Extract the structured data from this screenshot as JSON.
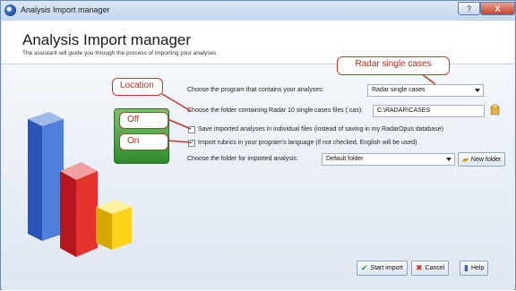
{
  "window": {
    "title": "Analysis Import manager",
    "help_glyph": "?",
    "close_glyph": "X"
  },
  "header": {
    "title": "Analysis Import manager",
    "subtitle": "The assistant will guide you through the process of importing your analyses"
  },
  "form": {
    "program_label": "Choose the program that contains your analyses:",
    "program_value": "Radar single cases",
    "folder_label": "Choose the folder containing Radar 10 single cases files (.cas):",
    "folder_value": "C:\\RADAR\\CASES",
    "save_individual_label": "Save imported analyses in individual files (instead of saving in my RadarOpus database)",
    "save_individual_checked": false,
    "import_rubrics_label": "Import rubrics in your program's language (if not checked, English will be used)",
    "import_rubrics_checked": true,
    "check_glyph": "✓",
    "target_folder_label": "Choose the folder for imported analysis:",
    "target_folder_value": "Default folder"
  },
  "buttons": {
    "new_folder": "New folder",
    "start_import": "Start import",
    "cancel": "Cancel",
    "help": "Help"
  },
  "callouts": {
    "radar": "Radar single cases",
    "location": "Location",
    "off": "Off",
    "on": "On"
  },
  "colors": {
    "accent": "#c53a27",
    "title_bar": "#c2d6ee",
    "body_bg": "#dfe7f1"
  },
  "icons": [
    "app-icon",
    "bar-chart-icon",
    "folder-icon",
    "new-folder-icon",
    "checkmark-icon",
    "cancel-x-icon",
    "help-book-icon"
  ]
}
